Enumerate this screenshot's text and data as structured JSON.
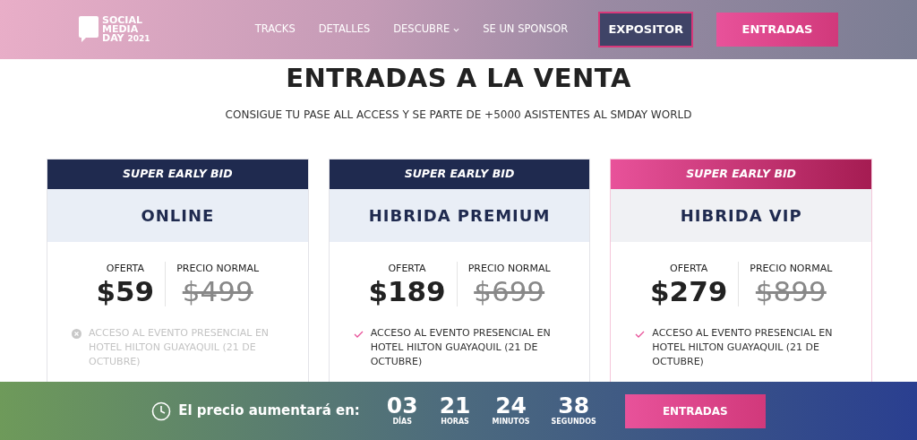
{
  "nav": {
    "logo_lines": [
      "SOCIAL",
      "MEDIA",
      "DAY"
    ],
    "logo_year": "2021",
    "links": [
      {
        "label": "TRACKS",
        "dropdown": false
      },
      {
        "label": "DETALLES",
        "dropdown": false
      },
      {
        "label": "DESCUBRE",
        "dropdown": true
      },
      {
        "label": "SE UN SPONSOR",
        "dropdown": false
      }
    ],
    "buttons": [
      {
        "label": "EXPOSITOR",
        "kind": "outline"
      },
      {
        "label": "ENTRADAS",
        "kind": "solid"
      }
    ]
  },
  "heading": "ENTRADAS A LA VENTA",
  "subheading": "CONSIGUE TU PASE ALL ACCESS Y SE PARTE DE +5000 ASISTENTES AL SMDAY WORLD",
  "plans": [
    {
      "ribbon": "SUPER EARLY BID",
      "featured": false,
      "name": "ONLINE",
      "offer_label": "OFERTA",
      "offer_price": "$59",
      "normal_label": "PRECIO NORMAL",
      "normal_price": "$499",
      "features": [
        {
          "text": "ACCESO AL EVENTO PRESENCIAL EN HOTEL HILTON GUAYAQUIL (21 DE OCTUBRE)",
          "included": false
        }
      ]
    },
    {
      "ribbon": "SUPER EARLY BID",
      "featured": false,
      "name": "HIBRIDA PREMIUM",
      "offer_label": "OFERTA",
      "offer_price": "$189",
      "normal_label": "PRECIO NORMAL",
      "normal_price": "$699",
      "features": [
        {
          "text": "ACCESO AL EVENTO PRESENCIAL EN HOTEL HILTON GUAYAQUIL (21 DE OCTUBRE)",
          "included": true
        }
      ]
    },
    {
      "ribbon": "SUPER EARLY BID",
      "featured": true,
      "name": "HIBRIDA VIP",
      "offer_label": "OFERTA",
      "offer_price": "$279",
      "normal_label": "PRECIO NORMAL",
      "normal_price": "$899",
      "features": [
        {
          "text": "ACCESO AL EVENTO PRESENCIAL EN HOTEL HILTON GUAYAQUIL (21 DE OCTUBRE)",
          "included": true
        }
      ]
    }
  ],
  "countdown": {
    "label": "El precio aumentará en:",
    "units": [
      {
        "value": "03",
        "unit": "DÍAS"
      },
      {
        "value": "21",
        "unit": "HORAS"
      },
      {
        "value": "24",
        "unit": "MINUTOS"
      },
      {
        "value": "38",
        "unit": "SEGUNDOS"
      }
    ],
    "button": "ENTRADAS"
  }
}
